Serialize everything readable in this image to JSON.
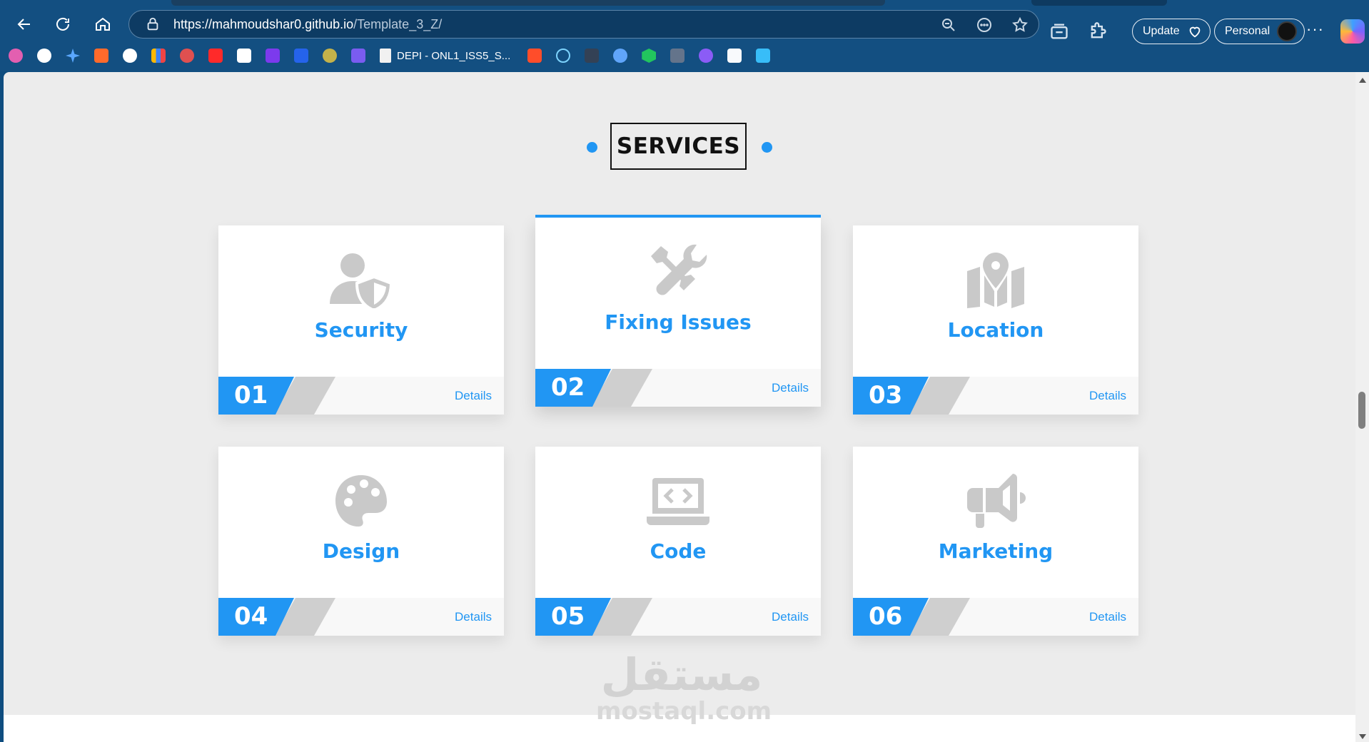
{
  "browser": {
    "url_host": "https://mahmoudshar0.github.io",
    "url_path": "/Template_3_Z/",
    "update_label": "Update",
    "profile_label": "Personal",
    "more_label": "···",
    "bookmarks_doc_label": "DEPI - ONL1_ISS5_S..."
  },
  "page": {
    "section_title": "SERVICES",
    "details_label": "Details",
    "accent_color": "#2196f3",
    "services": [
      {
        "number": "01",
        "title": "Security",
        "icon": "user-shield-icon"
      },
      {
        "number": "02",
        "title": "Fixing Issues",
        "icon": "tools-icon"
      },
      {
        "number": "03",
        "title": "Location",
        "icon": "map-location-icon"
      },
      {
        "number": "04",
        "title": "Design",
        "icon": "palette-icon"
      },
      {
        "number": "05",
        "title": "Code",
        "icon": "laptop-code-icon"
      },
      {
        "number": "06",
        "title": "Marketing",
        "icon": "bullhorn-icon"
      }
    ]
  },
  "watermark": {
    "arabic": "مستقل",
    "latin": "mostaql.com"
  }
}
